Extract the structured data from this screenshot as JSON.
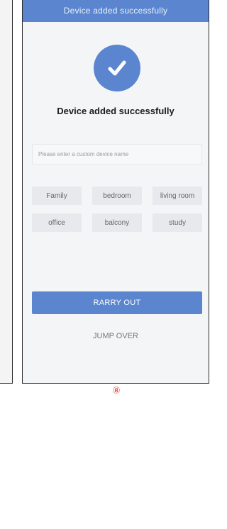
{
  "header": {
    "title": "Device added successfully"
  },
  "status": {
    "icon": "check-icon",
    "message": "Device added successfully"
  },
  "device_name": {
    "value": "",
    "placeholder": "Please enter a custom device name"
  },
  "room_tags": [
    {
      "label": "Family"
    },
    {
      "label": "bedroom"
    },
    {
      "label": "living room"
    },
    {
      "label": "office"
    },
    {
      "label": "balcony"
    },
    {
      "label": "study"
    }
  ],
  "actions": {
    "confirm_label": "RARRY OUT",
    "skip_label": "JUMP OVER"
  },
  "step_marker": "⑧",
  "colors": {
    "accent": "#5b86cf",
    "step_marker": "#e04a3a"
  }
}
